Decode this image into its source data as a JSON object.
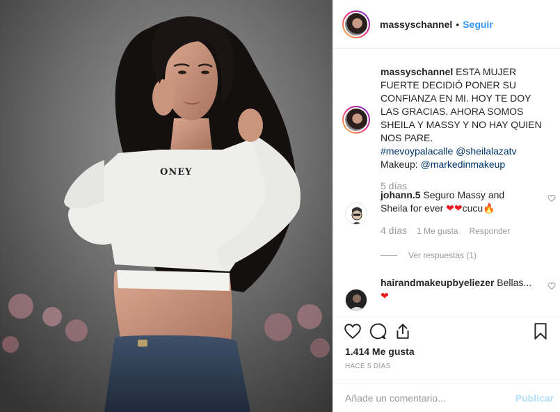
{
  "header": {
    "username": "massyschannel",
    "separator": "•",
    "follow_label": "Seguir"
  },
  "caption": {
    "username": "massyschannel",
    "line1": " ESTA MUJER FUERTE DECIDIÓ PONER SU CONFIANZA EN MI. HOY TE DOY LAS GRACIAS. AHORA SOMOS SHEILA Y MASSY Y NO HAY QUIEN NOS PARE.",
    "hashtag": "#mevoypalacalle",
    "mention1": "@sheilalazatv",
    "makeup_label": "Makeup: ",
    "mention2": "@markedinmakeup",
    "time": "5 días"
  },
  "comments": [
    {
      "username": "johann.5",
      "text": " Seguro Massy and Sheila for ever ",
      "suffix": "cucu",
      "time": "4 días",
      "likes": "1 Me gusta",
      "reply": "Responder"
    },
    {
      "username": "hairandmakeupbyeliezer",
      "text": " Bellas..."
    }
  ],
  "replies": {
    "label": "Ver respuestas (1)"
  },
  "actions": {
    "likes": "1.414 Me gusta",
    "ago": "HACE 5 DÍAS"
  },
  "add_comment": {
    "placeholder": "Añade un comentario...",
    "publish": "Publicar"
  },
  "photo": {
    "shirt_text": "ONEY"
  },
  "colors": {
    "link": "#003569",
    "follow": "#3897f0",
    "muted": "#999999",
    "publish_disabled": "#b2dffc"
  }
}
